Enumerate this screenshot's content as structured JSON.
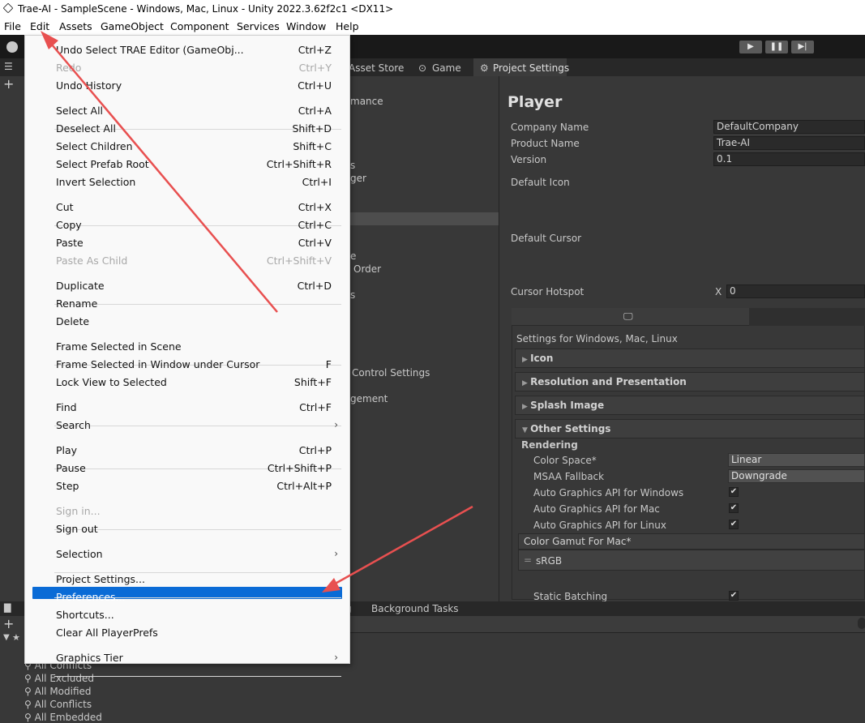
{
  "window": {
    "title": "Trae-AI - SampleScene - Windows, Mac, Linux - Unity 2022.3.62f2c1 <DX11>"
  },
  "menubar": [
    "File",
    "Edit",
    "Assets",
    "GameObject",
    "Component",
    "Services",
    "Window",
    "Help"
  ],
  "editor_tabs": {
    "asset_store": "Asset Store",
    "game": "Game",
    "project_settings": "Project Settings"
  },
  "categories_visible": [
    "mance",
    "s",
    "ger",
    "e",
    "Order",
    "s",
    "Control Settings",
    "gement"
  ],
  "player": {
    "heading": "Player",
    "company_name_label": "Company Name",
    "company_name": "DefaultCompany",
    "product_name_label": "Product Name",
    "product_name": "Trae-AI",
    "version_label": "Version",
    "version": "0.1",
    "default_icon_label": "Default Icon",
    "default_cursor_label": "Default Cursor",
    "cursor_hotspot_label": "Cursor Hotspot",
    "hotspot_x_label": "X",
    "hotspot_x": "0",
    "settings_for": "Settings for Windows, Mac, Linux",
    "sections": {
      "icon": "Icon",
      "resolution": "Resolution and Presentation",
      "splash": "Splash Image",
      "other": "Other Settings"
    },
    "rendering_label": "Rendering",
    "color_space_label": "Color Space*",
    "color_space": "Linear",
    "msaa_label": "MSAA Fallback",
    "msaa": "Downgrade",
    "auto_win_label": "Auto Graphics API  for Windows",
    "auto_mac_label": "Auto Graphics API  for Mac",
    "auto_linux_label": "Auto Graphics API  for Linux",
    "gamut_label": "Color Gamut For Mac*",
    "gamut_item": "sRGB",
    "static_batching_label": "Static Batching"
  },
  "bottom": {
    "tab_fragment": "g",
    "background_tasks": "Background Tasks",
    "project_items": [
      "All Conflicts",
      "All Excluded",
      "All Modified",
      "All Conflicts",
      "All Embedded"
    ]
  },
  "edit_menu": {
    "items": [
      {
        "label": "Undo Select TRAE Editor (GameObj...",
        "key": "Ctrl+Z",
        "disabled": false
      },
      {
        "label": "Redo",
        "key": "Ctrl+Y",
        "disabled": true
      },
      {
        "label": "Undo History",
        "key": "Ctrl+U",
        "disabled": false
      },
      {
        "label": "Select All",
        "key": "Ctrl+A",
        "disabled": false
      },
      {
        "label": "Deselect All",
        "key": "Shift+D",
        "disabled": false
      },
      {
        "label": "Select Children",
        "key": "Shift+C",
        "disabled": false
      },
      {
        "label": "Select Prefab Root",
        "key": "Ctrl+Shift+R",
        "disabled": false
      },
      {
        "label": "Invert Selection",
        "key": "Ctrl+I",
        "disabled": false
      },
      {
        "label": "Cut",
        "key": "Ctrl+X",
        "disabled": false
      },
      {
        "label": "Copy",
        "key": "Ctrl+C",
        "disabled": false
      },
      {
        "label": "Paste",
        "key": "Ctrl+V",
        "disabled": false
      },
      {
        "label": "Paste As Child",
        "key": "Ctrl+Shift+V",
        "disabled": true
      },
      {
        "label": "Duplicate",
        "key": "Ctrl+D",
        "disabled": false
      },
      {
        "label": "Rename",
        "key": "",
        "disabled": false
      },
      {
        "label": "Delete",
        "key": "",
        "disabled": false
      },
      {
        "label": "Frame Selected in Scene",
        "key": "",
        "disabled": false
      },
      {
        "label": "Frame Selected in Window under Cursor",
        "key": "F",
        "disabled": false
      },
      {
        "label": "Lock View to Selected",
        "key": "Shift+F",
        "disabled": false
      },
      {
        "label": "Find",
        "key": "Ctrl+F",
        "disabled": false
      },
      {
        "label": "Search",
        "key": "",
        "disabled": false
      },
      {
        "label": "Play",
        "key": "Ctrl+P",
        "disabled": false
      },
      {
        "label": "Pause",
        "key": "Ctrl+Shift+P",
        "disabled": false
      },
      {
        "label": "Step",
        "key": "Ctrl+Alt+P",
        "disabled": false
      },
      {
        "label": "Sign in...",
        "key": "",
        "disabled": true
      },
      {
        "label": "Sign out",
        "key": "",
        "disabled": false
      },
      {
        "label": "Selection",
        "key": "",
        "disabled": false
      },
      {
        "label": "Project Settings...",
        "key": "",
        "disabled": false
      },
      {
        "label": "Preferences...",
        "key": "",
        "disabled": false
      },
      {
        "label": "Shortcuts...",
        "key": "",
        "disabled": false
      },
      {
        "label": "Clear All PlayerPrefs",
        "key": "",
        "disabled": false
      },
      {
        "label": "Graphics Tier",
        "key": "",
        "disabled": false
      }
    ],
    "highlighted": "Preferences..."
  },
  "colors": {
    "annotation_arrow": "#e85050",
    "highlight": "#0a6bd6",
    "editor_bg": "#383838"
  },
  "icons": [
    "unity-logo-icon",
    "play-icon",
    "pause-icon",
    "step-icon",
    "account-icon",
    "gamepad-icon",
    "gear-icon",
    "monitor-icon",
    "chevron-right-icon",
    "checkmark-icon",
    "star-icon",
    "search-icon"
  ]
}
